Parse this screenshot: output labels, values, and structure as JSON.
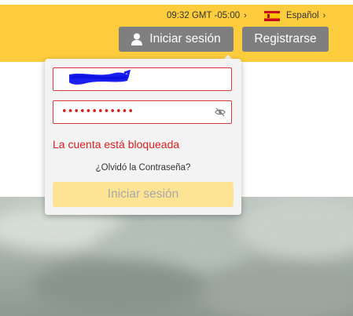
{
  "header": {
    "time": "09:32",
    "timezone": "GMT -05:00",
    "language": "Español",
    "login_label": "Iniciar sesión",
    "register_label": "Registrarse",
    "accent_color": "#fdcd3d"
  },
  "login_popup": {
    "username_value": "",
    "password_mask": "••••••••••••",
    "error_message": "La cuenta está bloqueada",
    "forgot_password": "¿Olvidó la Contraseña?",
    "submit_label": "Iniciar sesión"
  },
  "icons": [
    "user-icon",
    "spain-flag-icon",
    "chevron-right-icon",
    "eye-hidden-icon"
  ]
}
